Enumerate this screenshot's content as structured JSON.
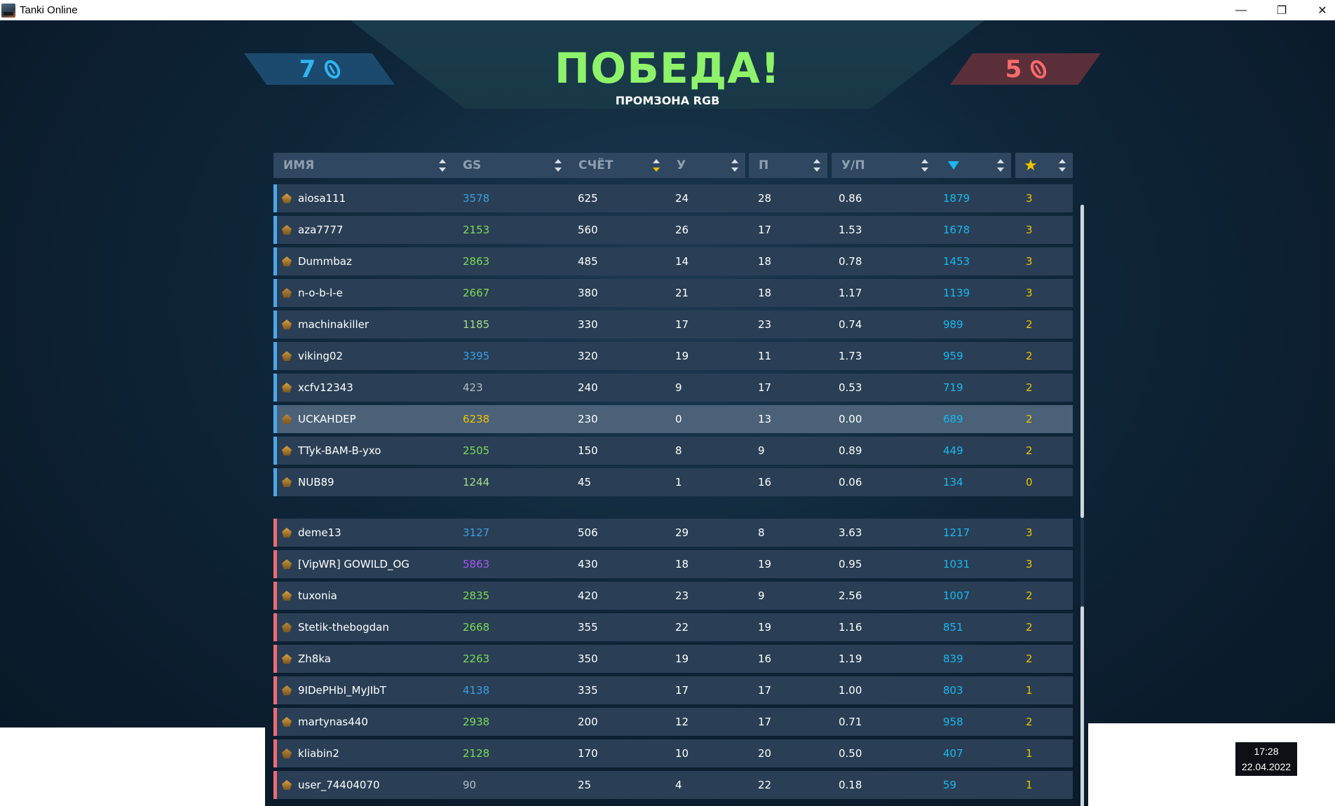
{
  "window": {
    "title": "Tanki Online"
  },
  "controls": {
    "minimize": "—",
    "restore": "❐",
    "close": "✕"
  },
  "header": {
    "victory": "ПОБЕДА!",
    "map": "ПРОМЗОНА RGB"
  },
  "score": {
    "blue": "7",
    "red": "5"
  },
  "colors": {
    "blue_team": "#4aa8ea",
    "red_team": "#ef6b72",
    "crystal": "#1ab8f0",
    "star": "#f3c200",
    "victory": "#8ef36a"
  },
  "columns": {
    "name": "ИМЯ",
    "gs": "GS",
    "score": "СЧЁТ",
    "kills": "У",
    "deaths": "П",
    "kd": "У/П",
    "crystals_icon": "gem-icon",
    "stars_icon": "star-icon"
  },
  "blue_team": [
    {
      "name": "aiosa111",
      "gs": "3578",
      "gs_color": "#3a9de0",
      "score": "625",
      "kills": "24",
      "deaths": "28",
      "kd": "0.86",
      "crystals": "1879",
      "stars": "3"
    },
    {
      "name": "aza7777",
      "gs": "2153",
      "gs_color": "#7ed957",
      "score": "560",
      "kills": "26",
      "deaths": "17",
      "kd": "1.53",
      "crystals": "1678",
      "stars": "3"
    },
    {
      "name": "Dummbaz",
      "gs": "2863",
      "gs_color": "#7ed957",
      "score": "485",
      "kills": "14",
      "deaths": "18",
      "kd": "0.78",
      "crystals": "1453",
      "stars": "3"
    },
    {
      "name": "n-o-b-l-e",
      "gs": "2667",
      "gs_color": "#7ed957",
      "score": "380",
      "kills": "21",
      "deaths": "18",
      "kd": "1.17",
      "crystals": "1139",
      "stars": "3"
    },
    {
      "name": "machinakiller",
      "gs": "1185",
      "gs_color": "#a6d98a",
      "score": "330",
      "kills": "17",
      "deaths": "23",
      "kd": "0.74",
      "crystals": "989",
      "stars": "2"
    },
    {
      "name": "viking02",
      "gs": "3395",
      "gs_color": "#3a9de0",
      "score": "320",
      "kills": "19",
      "deaths": "11",
      "kd": "1.73",
      "crystals": "959",
      "stars": "2"
    },
    {
      "name": "xcfv12343",
      "gs": "423",
      "gs_color": "#b5bcc4",
      "score": "240",
      "kills": "9",
      "deaths": "17",
      "kd": "0.53",
      "crystals": "719",
      "stars": "2"
    },
    {
      "name": "UCKAHDEP",
      "gs": "6238",
      "gs_color": "#f3c200",
      "score": "230",
      "kills": "0",
      "deaths": "13",
      "kd": "0.00",
      "crystals": "689",
      "stars": "2",
      "highlight": true
    },
    {
      "name": "TTyk-BAM-B-yxo",
      "gs": "2505",
      "gs_color": "#7ed957",
      "score": "150",
      "kills": "8",
      "deaths": "9",
      "kd": "0.89",
      "crystals": "449",
      "stars": "2"
    },
    {
      "name": "NUB89",
      "gs": "1244",
      "gs_color": "#a6d98a",
      "score": "45",
      "kills": "1",
      "deaths": "16",
      "kd": "0.06",
      "crystals": "134",
      "stars": "0"
    }
  ],
  "red_team": [
    {
      "name": "deme13",
      "gs": "3127",
      "gs_color": "#3a9de0",
      "score": "506",
      "kills": "29",
      "deaths": "8",
      "kd": "3.63",
      "crystals": "1217",
      "stars": "3"
    },
    {
      "name": "[VipWR] GOWILD_OG",
      "gs": "5863",
      "gs_color": "#a855f7",
      "score": "430",
      "kills": "18",
      "deaths": "19",
      "kd": "0.95",
      "crystals": "1031",
      "stars": "3"
    },
    {
      "name": "tuxonia",
      "gs": "2835",
      "gs_color": "#7ed957",
      "score": "420",
      "kills": "23",
      "deaths": "9",
      "kd": "2.56",
      "crystals": "1007",
      "stars": "2"
    },
    {
      "name": "Stetik-thebogdan",
      "gs": "2668",
      "gs_color": "#7ed957",
      "score": "355",
      "kills": "22",
      "deaths": "19",
      "kd": "1.16",
      "crystals": "851",
      "stars": "2"
    },
    {
      "name": "Zh8ka",
      "gs": "2263",
      "gs_color": "#7ed957",
      "score": "350",
      "kills": "19",
      "deaths": "16",
      "kd": "1.19",
      "crystals": "839",
      "stars": "2"
    },
    {
      "name": "9IDePHbI_MyJIbT",
      "gs": "4138",
      "gs_color": "#3a9de0",
      "score": "335",
      "kills": "17",
      "deaths": "17",
      "kd": "1.00",
      "crystals": "803",
      "stars": "1"
    },
    {
      "name": "martynas440",
      "gs": "2938",
      "gs_color": "#7ed957",
      "score": "200",
      "kills": "12",
      "deaths": "17",
      "kd": "0.71",
      "crystals": "958",
      "stars": "2"
    },
    {
      "name": "kliabin2",
      "gs": "2128",
      "gs_color": "#7ed957",
      "score": "170",
      "kills": "10",
      "deaths": "20",
      "kd": "0.50",
      "crystals": "407",
      "stars": "1"
    },
    {
      "name": "user_74404070",
      "gs": "90",
      "gs_color": "#b5bcc4",
      "score": "25",
      "kills": "4",
      "deaths": "22",
      "kd": "0.18",
      "crystals": "59",
      "stars": "1"
    }
  ],
  "taskbar": {
    "time": "17:28",
    "date": "22.04.2022"
  }
}
